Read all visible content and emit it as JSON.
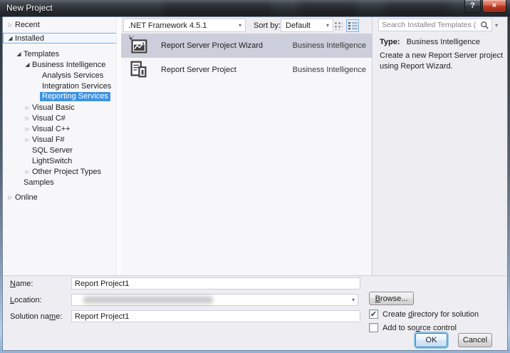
{
  "window": {
    "title": "New Project"
  },
  "icons": {
    "help_glyph": "?",
    "close_glyph": "×",
    "tree_collapsed": "▷",
    "tree_expanded": "◢",
    "combo_arrow": "▾",
    "search_arrow": "▾",
    "check": "✔"
  },
  "colors": {
    "accent_selection": "#3e93e0",
    "inactive_selection": "#cccedb",
    "close_button_red": "#bb3a26",
    "panel_gray": "#eeeef2",
    "focus_border": "#7cb0dd"
  },
  "toolbar": {
    "framework_value": ".NET Framework 4.5.1",
    "sort_by_label": "Sort by:",
    "sort_value": "Default"
  },
  "search": {
    "placeholder": "Search Installed Templates (Ctrl+E)",
    "value": ""
  },
  "tree": {
    "items": [
      {
        "label": "Recent",
        "level": 0,
        "state": "collapsed"
      },
      {
        "label": "Installed",
        "level": 0,
        "state": "expanded",
        "focused": true
      },
      {
        "label": "Templates",
        "level": 1,
        "state": "expanded"
      },
      {
        "label": "Business Intelligence",
        "level": 2,
        "state": "expanded"
      },
      {
        "label": "Analysis Services",
        "level": 3,
        "state": "none"
      },
      {
        "label": "Integration Services",
        "level": 3,
        "state": "none"
      },
      {
        "label": "Reporting Services",
        "level": 3,
        "state": "none",
        "selected": true
      },
      {
        "label": "Visual Basic",
        "level": 2,
        "state": "collapsed"
      },
      {
        "label": "Visual C#",
        "level": 2,
        "state": "collapsed"
      },
      {
        "label": "Visual C++",
        "level": 2,
        "state": "collapsed"
      },
      {
        "label": "Visual F#",
        "level": 2,
        "state": "collapsed"
      },
      {
        "label": "SQL Server",
        "level": 2,
        "state": "none"
      },
      {
        "label": "LightSwitch",
        "level": 2,
        "state": "none"
      },
      {
        "label": "Other Project Types",
        "level": 2,
        "state": "collapsed"
      },
      {
        "label": "Samples",
        "level": 1,
        "state": "none"
      },
      {
        "label": "Online",
        "level": 0,
        "state": "collapsed"
      }
    ]
  },
  "list": {
    "items": [
      {
        "name": "Report Server Project Wizard",
        "category": "Business Intelligence",
        "icon": "report-wizard-icon",
        "selected": true
      },
      {
        "name": "Report Server Project",
        "category": "Business Intelligence",
        "icon": "report-document-icon",
        "selected": false
      }
    ]
  },
  "info": {
    "type_label": "Type:",
    "type_value": "Business Intelligence",
    "description": "Create a new Report Server project using Report Wizard."
  },
  "form": {
    "name_label": {
      "pre": "",
      "u": "N",
      "post": "ame:"
    },
    "name_value": "Report Project1",
    "location_label": {
      "pre": "",
      "u": "L",
      "post": "ocation:"
    },
    "location_value": "",
    "solution_label": {
      "pre": "Solution na",
      "u": "m",
      "post": "e:"
    },
    "solution_value": "Report Project1",
    "browse_label": {
      "pre": "",
      "u": "B",
      "post": "rowse..."
    },
    "create_dir_label": {
      "pre": "Create ",
      "u": "d",
      "post": "irectory for solution"
    },
    "create_dir_checked": true,
    "source_control_label": {
      "pre": "Add to so",
      "u": "u",
      "post": "rce control"
    },
    "source_control_checked": false,
    "ok_label": "OK",
    "cancel_label": "Cancel"
  }
}
